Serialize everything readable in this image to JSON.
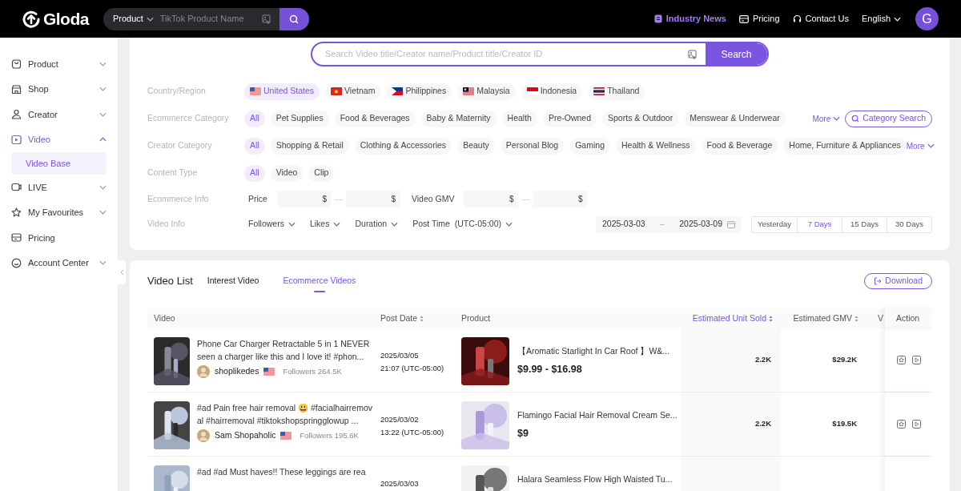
{
  "header": {
    "logo": "Gloda",
    "search": {
      "scope": "Product",
      "placeholder": "TikTok Product Name"
    },
    "nav": [
      {
        "label": "Industry News",
        "highlighted": true
      },
      {
        "label": "Pricing",
        "highlighted": false
      },
      {
        "label": "Contact Us",
        "highlighted": false
      }
    ],
    "language": "English",
    "avatar": "G"
  },
  "sidebar": {
    "items": [
      {
        "label": "Product",
        "kind": "menu",
        "expanded": false,
        "selected": false
      },
      {
        "label": "Shop",
        "kind": "menu",
        "expanded": false,
        "selected": false
      },
      {
        "label": "Creator",
        "kind": "menu",
        "expanded": false,
        "selected": false
      },
      {
        "label": "Video",
        "kind": "menu",
        "expanded": true,
        "selected": true,
        "children": [
          {
            "label": "Video Base",
            "selected": true
          }
        ]
      },
      {
        "label": "LIVE",
        "kind": "menu",
        "expanded": false,
        "selected": false
      },
      {
        "label": "My Favourites",
        "kind": "menu",
        "expanded": false,
        "selected": false
      },
      {
        "label": "Pricing",
        "kind": "link",
        "selected": false
      },
      {
        "label": "Account Center",
        "kind": "menu",
        "expanded": false,
        "selected": false
      }
    ]
  },
  "filters": {
    "search": {
      "placeholder": "Search Video title/Creator name/Product title/Creator ID",
      "button": "Search"
    },
    "rows": [
      {
        "label": "Country/Region",
        "kind": "chips",
        "options": [
          {
            "label": "United States",
            "selected": true
          },
          {
            "label": "Vietnam",
            "selected": false
          },
          {
            "label": "Philippines",
            "selected": false
          },
          {
            "label": "Malaysia",
            "selected": false
          },
          {
            "label": "Indonesia",
            "selected": false
          },
          {
            "label": "Thailand",
            "selected": false
          }
        ]
      },
      {
        "label": "Ecommerce Category",
        "kind": "chips",
        "options": [
          {
            "label": "All",
            "selected": true
          },
          {
            "label": "Pet Supplies",
            "selected": false
          },
          {
            "label": "Food & Beverages",
            "selected": false
          },
          {
            "label": "Baby & Maternity",
            "selected": false
          },
          {
            "label": "Health",
            "selected": false
          },
          {
            "label": "Pre-Owned",
            "selected": false
          },
          {
            "label": "Sports & Outdoor",
            "selected": false
          },
          {
            "label": "Menswear & Underwear",
            "selected": false
          }
        ],
        "more": "More",
        "extra_button": "Category Search"
      },
      {
        "label": "Creator Category",
        "kind": "chips",
        "options": [
          {
            "label": "All",
            "selected": true
          },
          {
            "label": "Shopping & Retail",
            "selected": false
          },
          {
            "label": "Clothing & Accessories",
            "selected": false
          },
          {
            "label": "Beauty",
            "selected": false
          },
          {
            "label": "Personal Blog",
            "selected": false
          },
          {
            "label": "Gaming",
            "selected": false
          },
          {
            "label": "Health & Wellness",
            "selected": false
          },
          {
            "label": "Food & Beverage",
            "selected": false
          },
          {
            "label": "Home, Furniture & Appliances",
            "selected": false
          }
        ],
        "more": "More"
      },
      {
        "label": "Content Type",
        "kind": "chips",
        "options": [
          {
            "label": "All",
            "selected": true
          },
          {
            "label": "Video",
            "selected": false
          },
          {
            "label": "Clip",
            "selected": false
          }
        ]
      },
      {
        "label": "Ecommerce Info",
        "kind": "ranges",
        "ranges": [
          {
            "label": "Price",
            "unit": "$",
            "separator": "—"
          },
          {
            "label": "Video GMV",
            "unit": "$",
            "separator": "—"
          }
        ]
      },
      {
        "label": "Video Info",
        "kind": "dropdowns",
        "dropdowns": [
          "Followers",
          "Likes",
          "Duration",
          "Post Time  (UTC-05:00)"
        ],
        "date_start": "2025-03-03",
        "date_separator": "–",
        "date_end": "2025-03-09",
        "presets": [
          {
            "label": "Yesterday",
            "selected": false
          },
          {
            "label": "7 Days",
            "selected": true
          },
          {
            "label": "15 Days",
            "selected": false
          },
          {
            "label": "30 Days",
            "selected": false
          }
        ]
      }
    ]
  },
  "video_list": {
    "title": "Video List",
    "tabs": [
      {
        "label": "Interest Video",
        "selected": false
      },
      {
        "label": "Ecommerce Videos",
        "selected": true
      }
    ],
    "download": "Download",
    "columns": [
      {
        "label": "Video",
        "sortable": false,
        "sorted": false
      },
      {
        "label": "Post Date",
        "sortable": true,
        "sorted": false
      },
      {
        "label": "Product",
        "sortable": false,
        "sorted": false
      },
      {
        "label": "Estimated Unit Sold",
        "sortable": true,
        "sorted": true
      },
      {
        "label": "Estimated GMV",
        "sortable": true,
        "sorted": false
      },
      {
        "label": "V"
      },
      {
        "label": "Action",
        "sortable": false,
        "sorted": false
      }
    ],
    "rows": [
      {
        "title": "Phone Car Charger Retractable 5 in 1 NEVER seen a charger like this and I love it! #phon...",
        "creator": "shoplikedes",
        "followers": "Followers 264.5K",
        "date": "2025/03/05",
        "time": "21:07 (UTC-05:00)",
        "product": "【Aromatic Starlight In Car Roof 】W&...",
        "price": "$9.99 - $16.98",
        "units": "2.2K",
        "gmv": "$29.2K"
      },
      {
        "title": "#ad Pain free hair removal 😃 #facialhairremoval #hairremoval #tiktokshopspringglowup ...",
        "creator": "Sam Shopaholic",
        "followers": "Followers 195.6K",
        "date": "2025/03/02",
        "time": "13:22 (UTC-05:00)",
        "product": "Flamingo Facial Hair Removal Cream Se...",
        "price": "$9",
        "units": "2.2K",
        "gmv": "$19.5K"
      },
      {
        "title": "#ad #ad Must haves!! These leggings are rea",
        "date": "2025/03/03",
        "product": "Halara Seamless Flow High Waisted Tu..."
      }
    ]
  }
}
